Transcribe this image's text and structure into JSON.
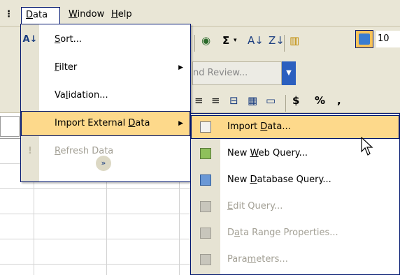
{
  "menubar": {
    "items": [
      {
        "label": "Data",
        "mnemonic": "D",
        "rest": "ata",
        "state": "open"
      },
      {
        "label": "Window",
        "mnemonic": "W",
        "rest": "indow"
      },
      {
        "label": "Help",
        "mnemonic": "H",
        "rest": "elp"
      }
    ]
  },
  "toolbar": {
    "sum_glyph": "Σ",
    "font_size_value": "10",
    "review_label": "nd Review...",
    "currency_symbol": "$",
    "percent_symbol": "%",
    "comma_symbol": ","
  },
  "data_menu": {
    "items": [
      {
        "label": "Sort...",
        "pre": "",
        "u": "S",
        "post": "ort...",
        "icon": "sort-ascending-icon"
      },
      {
        "label": "Filter",
        "pre": "",
        "u": "F",
        "post": "ilter",
        "submenu": true
      },
      {
        "label": "Validation...",
        "pre": "Va",
        "u": "l",
        "post": "idation..."
      },
      {
        "label": "Import External Data",
        "pre": "Import External ",
        "u": "D",
        "post": "ata",
        "submenu": true,
        "highlighted": true
      },
      {
        "label": "Refresh Data",
        "pre": "",
        "u": "R",
        "post": "efresh Data",
        "disabled": true,
        "icon": "exclamation-icon"
      }
    ],
    "expand_glyph": "»"
  },
  "import_submenu": {
    "items": [
      {
        "label": "Import Data...",
        "pre": "Import ",
        "u": "D",
        "post": "ata...",
        "highlighted": true,
        "icon": "import-data-icon"
      },
      {
        "label": "New Web Query...",
        "pre": "New ",
        "u": "W",
        "post": "eb Query...",
        "icon": "web-query-icon"
      },
      {
        "label": "New Database Query...",
        "pre": "New ",
        "u": "D",
        "post": "atabase Query...",
        "icon": "database-query-icon"
      },
      {
        "label": "Edit Query...",
        "pre": "",
        "u": "E",
        "post": "dit Query...",
        "disabled": true,
        "icon": "edit-query-icon"
      },
      {
        "label": "Data Range Properties...",
        "pre": "D",
        "u": "a",
        "post": "ta Range Properties...",
        "disabled": true,
        "icon": "range-properties-icon"
      },
      {
        "label": "Parameters...",
        "pre": "Para",
        "u": "m",
        "post": "eters...",
        "disabled": true,
        "icon": "parameters-icon"
      }
    ]
  },
  "colors": {
    "menu_highlight": "#fdd98b",
    "menu_border": "#00156e",
    "chrome": "#e9e6d6",
    "disabled_text": "#a3a095"
  }
}
